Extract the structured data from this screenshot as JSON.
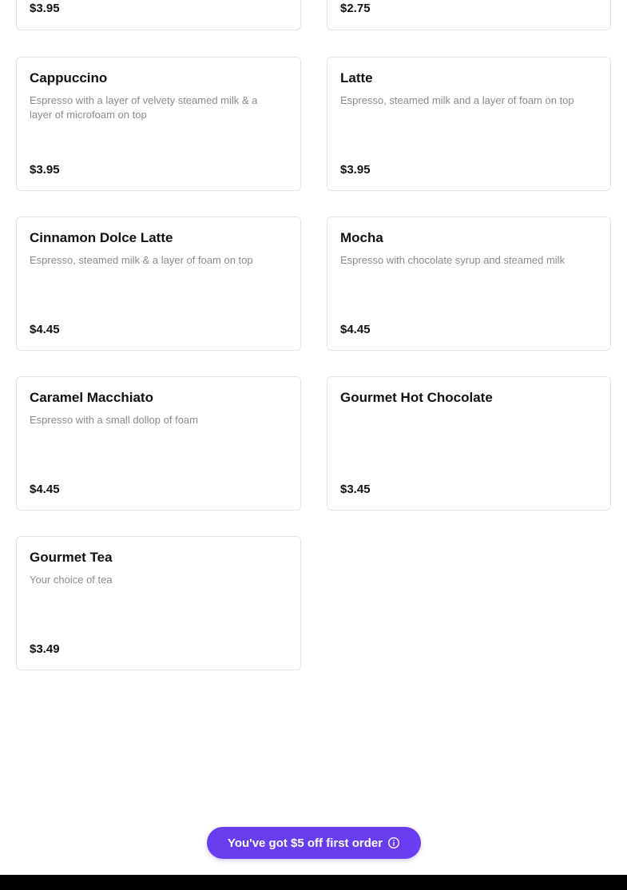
{
  "menu": {
    "items": [
      {
        "name": "",
        "description": "",
        "price": "$3.95"
      },
      {
        "name": "",
        "description": "",
        "price": "$2.75"
      },
      {
        "name": "Cappuccino",
        "description": "Espresso with a layer of velvety steamed milk & a layer of microfoam on top",
        "price": "$3.95"
      },
      {
        "name": "Latte",
        "description": "Espresso, steamed milk and a layer of foam on top",
        "price": "$3.95"
      },
      {
        "name": "Cinnamon Dolce Latte",
        "description": "Espresso, steamed milk & a layer of foam on top",
        "price": "$4.45"
      },
      {
        "name": "Mocha",
        "description": "Espresso with chocolate syrup and steamed milk",
        "price": "$4.45"
      },
      {
        "name": "Caramel Macchiato",
        "description": "Espresso with a small dollop of foam",
        "price": "$4.45"
      },
      {
        "name": "Gourmet Hot Chocolate",
        "description": "",
        "price": "$3.45"
      },
      {
        "name": "Gourmet Tea",
        "description": "Your choice of tea",
        "price": "$3.49"
      }
    ]
  },
  "promo": {
    "label": "You've got $5 off first order",
    "icon": "info-icon",
    "color": "#6a3cf0"
  }
}
